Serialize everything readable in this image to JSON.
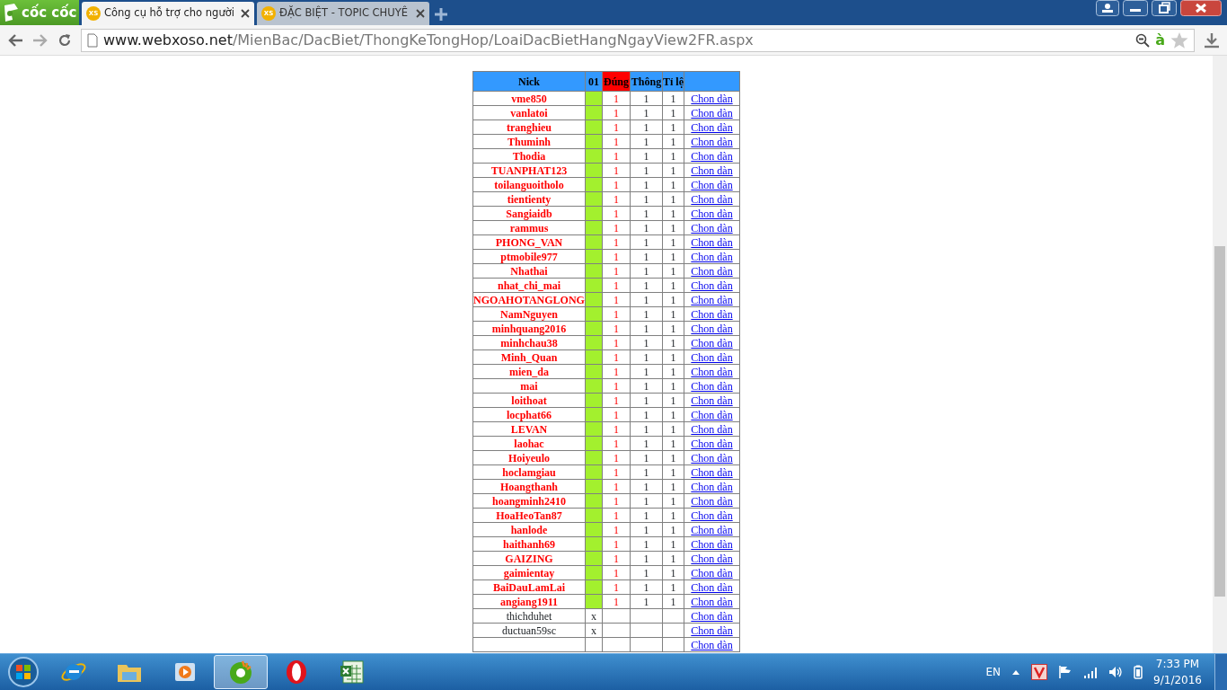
{
  "browser": {
    "logo": "cốc cốc",
    "tabs": [
      {
        "favicon": "XS",
        "title": "Công cụ hỗ trợ cho người",
        "selected": true
      },
      {
        "favicon": "XS",
        "title": "ĐẶC BIỆT - TOPIC CHUYÊ",
        "selected": false
      }
    ],
    "address": {
      "host": "www.webxoso.net",
      "path": "/MienBac/DacBiet/ThongKeTongHop/LoaiDacBietHangNgayView2FR.aspx"
    },
    "lang_icon": "à"
  },
  "table": {
    "columns": [
      "Nick",
      "01",
      "Đúng",
      "Thông",
      "Tỉ lệ"
    ],
    "rows": [
      {
        "kind": "hit",
        "nick": "vme850",
        "dung": "1",
        "thong": "1",
        "tile": "1",
        "link": "Chon dàn"
      },
      {
        "kind": "hit",
        "nick": "vanlatoi",
        "dung": "1",
        "thong": "1",
        "tile": "1",
        "link": "Chon dàn"
      },
      {
        "kind": "hit",
        "nick": "tranghieu",
        "dung": "1",
        "thong": "1",
        "tile": "1",
        "link": "Chon dàn"
      },
      {
        "kind": "hit",
        "nick": "Thuminh",
        "dung": "1",
        "thong": "1",
        "tile": "1",
        "link": "Chon dàn"
      },
      {
        "kind": "hit",
        "nick": "Thodia",
        "dung": "1",
        "thong": "1",
        "tile": "1",
        "link": "Chon dàn"
      },
      {
        "kind": "hit",
        "nick": "TUANPHAT123",
        "dung": "1",
        "thong": "1",
        "tile": "1",
        "link": "Chon dàn"
      },
      {
        "kind": "hit",
        "nick": "toilanguoitholo",
        "dung": "1",
        "thong": "1",
        "tile": "1",
        "link": "Chon dàn"
      },
      {
        "kind": "hit",
        "nick": "tientienty",
        "dung": "1",
        "thong": "1",
        "tile": "1",
        "link": "Chon dàn"
      },
      {
        "kind": "hit",
        "nick": "Sangiaidb",
        "dung": "1",
        "thong": "1",
        "tile": "1",
        "link": "Chon dàn"
      },
      {
        "kind": "hit",
        "nick": "rammus",
        "dung": "1",
        "thong": "1",
        "tile": "1",
        "link": "Chon dàn"
      },
      {
        "kind": "hit",
        "nick": "PHONG_VAN",
        "dung": "1",
        "thong": "1",
        "tile": "1",
        "link": "Chon dàn"
      },
      {
        "kind": "hit",
        "nick": "ptmobile977",
        "dung": "1",
        "thong": "1",
        "tile": "1",
        "link": "Chon dàn"
      },
      {
        "kind": "hit",
        "nick": "Nhathai",
        "dung": "1",
        "thong": "1",
        "tile": "1",
        "link": "Chon dàn"
      },
      {
        "kind": "hit",
        "nick": "nhat_chi_mai",
        "dung": "1",
        "thong": "1",
        "tile": "1",
        "link": "Chon dàn"
      },
      {
        "kind": "hit",
        "nick": "NGOAHOTANGLONG",
        "dung": "1",
        "thong": "1",
        "tile": "1",
        "link": "Chon dàn"
      },
      {
        "kind": "hit",
        "nick": "NamNguyen",
        "dung": "1",
        "thong": "1",
        "tile": "1",
        "link": "Chon dàn"
      },
      {
        "kind": "hit",
        "nick": "minhquang2016",
        "dung": "1",
        "thong": "1",
        "tile": "1",
        "link": "Chon dàn"
      },
      {
        "kind": "hit",
        "nick": "minhchau38",
        "dung": "1",
        "thong": "1",
        "tile": "1",
        "link": "Chon dàn"
      },
      {
        "kind": "hit",
        "nick": "Minh_Quan",
        "dung": "1",
        "thong": "1",
        "tile": "1",
        "link": "Chon dàn"
      },
      {
        "kind": "hit",
        "nick": "mien_da",
        "dung": "1",
        "thong": "1",
        "tile": "1",
        "link": "Chon dàn"
      },
      {
        "kind": "hit",
        "nick": "mai",
        "dung": "1",
        "thong": "1",
        "tile": "1",
        "link": "Chon dàn"
      },
      {
        "kind": "hit",
        "nick": "loithoat",
        "dung": "1",
        "thong": "1",
        "tile": "1",
        "link": "Chon dàn"
      },
      {
        "kind": "hit",
        "nick": "locphat66",
        "dung": "1",
        "thong": "1",
        "tile": "1",
        "link": "Chon dàn"
      },
      {
        "kind": "hit",
        "nick": "LEVAN",
        "dung": "1",
        "thong": "1",
        "tile": "1",
        "link": "Chon dàn"
      },
      {
        "kind": "hit",
        "nick": "laohac",
        "dung": "1",
        "thong": "1",
        "tile": "1",
        "link": "Chon dàn"
      },
      {
        "kind": "hit",
        "nick": "Hoiyeulo",
        "dung": "1",
        "thong": "1",
        "tile": "1",
        "link": "Chon dàn"
      },
      {
        "kind": "hit",
        "nick": "hoclamgiau",
        "dung": "1",
        "thong": "1",
        "tile": "1",
        "link": "Chon dàn"
      },
      {
        "kind": "hit",
        "nick": "Hoangthanh",
        "dung": "1",
        "thong": "1",
        "tile": "1",
        "link": "Chon dàn"
      },
      {
        "kind": "hit",
        "nick": "hoangminh2410",
        "dung": "1",
        "thong": "1",
        "tile": "1",
        "link": "Chon dàn"
      },
      {
        "kind": "hit",
        "nick": "HoaHeoTan87",
        "dung": "1",
        "thong": "1",
        "tile": "1",
        "link": "Chon dàn"
      },
      {
        "kind": "hit",
        "nick": "hanlode",
        "dung": "1",
        "thong": "1",
        "tile": "1",
        "link": "Chon dàn"
      },
      {
        "kind": "hit",
        "nick": "haithanh69",
        "dung": "1",
        "thong": "1",
        "tile": "1",
        "link": "Chon dàn"
      },
      {
        "kind": "hit",
        "nick": "GAIZING",
        "dung": "1",
        "thong": "1",
        "tile": "1",
        "link": "Chon dàn"
      },
      {
        "kind": "hit",
        "nick": "gaimientay",
        "dung": "1",
        "thong": "1",
        "tile": "1",
        "link": "Chon dàn"
      },
      {
        "kind": "hit",
        "nick": "BaiDauLamLai",
        "dung": "1",
        "thong": "1",
        "tile": "1",
        "link": "Chon dàn"
      },
      {
        "kind": "hit",
        "nick": "angiang1911",
        "dung": "1",
        "thong": "1",
        "tile": "1",
        "link": "Chon dàn"
      },
      {
        "kind": "miss",
        "nick": "thichduhet",
        "col_01": "x",
        "link": "Chon dàn"
      },
      {
        "kind": "miss",
        "nick": "ductuan59sc",
        "col_01": "x",
        "link": "Chon dàn"
      },
      {
        "kind": "blank",
        "link": "Chon dàn"
      }
    ]
  },
  "taskbar": {
    "apps": [
      {
        "kind": "ie",
        "selected": false
      },
      {
        "kind": "folder",
        "selected": false
      },
      {
        "kind": "media",
        "selected": false
      },
      {
        "kind": "browser",
        "selected": true
      },
      {
        "kind": "opera",
        "selected": false
      },
      {
        "kind": "excel",
        "selected": false
      }
    ],
    "language": "EN",
    "time": "7:33 PM",
    "date": "9/1/2016"
  }
}
